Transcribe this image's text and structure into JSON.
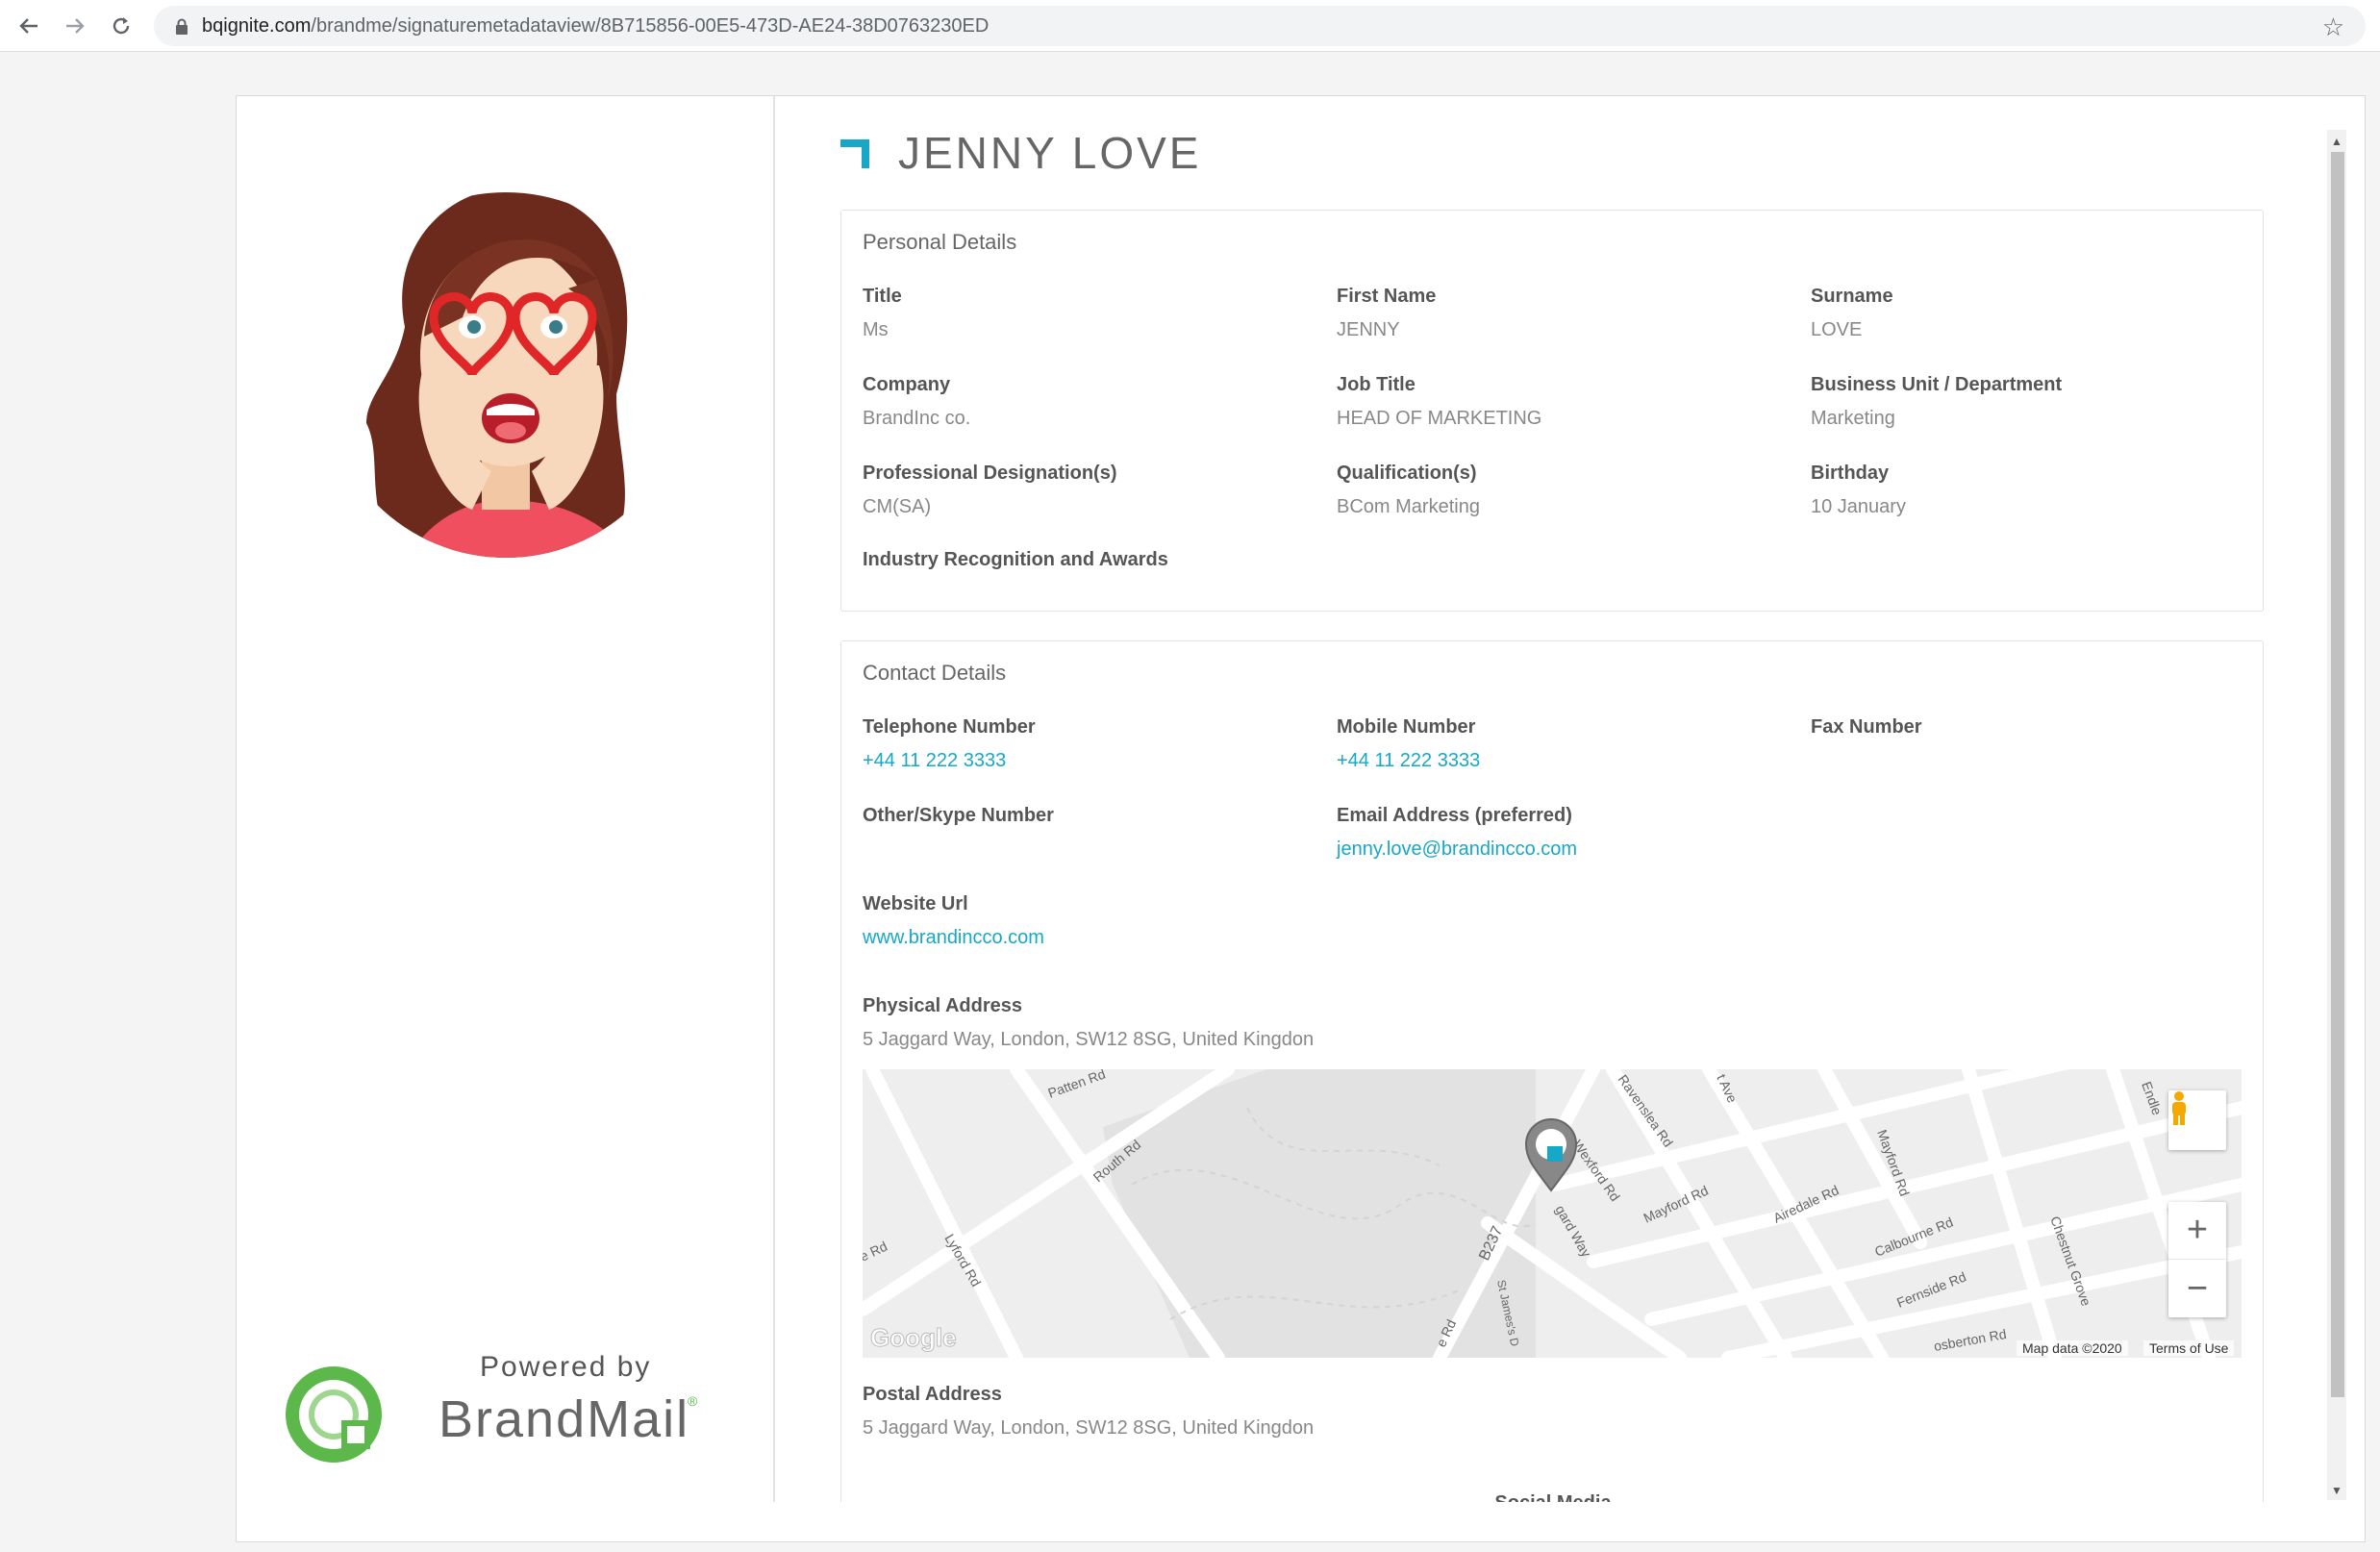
{
  "browser": {
    "url_host": "bqignite.com",
    "url_path": "/brandme/signaturemetadataview/8B715856-00E5-473D-AE24-38D0763230ED",
    "icons": [
      "back-arrow-icon",
      "forward-arrow-icon",
      "reload-icon",
      "lock-icon",
      "star-icon"
    ]
  },
  "profile": {
    "name": "JENNY LOVE"
  },
  "personal": {
    "heading": "Personal Details",
    "fields": [
      {
        "label": "Title",
        "value": "Ms"
      },
      {
        "label": "First Name",
        "value": "JENNY"
      },
      {
        "label": "Surname",
        "value": "LOVE"
      },
      {
        "label": "Company",
        "value": "BrandInc co."
      },
      {
        "label": "Job Title",
        "value": "HEAD OF MARKETING"
      },
      {
        "label": "Business Unit / Department",
        "value": "Marketing"
      },
      {
        "label": "Professional Designation(s)",
        "value": "CM(SA)"
      },
      {
        "label": "Qualification(s)",
        "value": "BCom Marketing"
      },
      {
        "label": "Birthday",
        "value": "10 January"
      },
      {
        "label": "Industry Recognition and Awards",
        "value": ""
      }
    ]
  },
  "contact": {
    "heading": "Contact Details",
    "fields": [
      {
        "label": "Telephone Number",
        "value": "+44 11 222 3333"
      },
      {
        "label": "Mobile Number",
        "value": "+44 11 222 3333"
      },
      {
        "label": "Fax Number",
        "value": ""
      },
      {
        "label": "Other/Skype Number",
        "value": ""
      },
      {
        "label": "Email Address (preferred)",
        "value": "jenny.love@brandincco.com"
      },
      {
        "label": "Website Url",
        "value": "www.brandincco.com"
      },
      {
        "label": "Physical Address",
        "value": "5 Jaggard Way, London, SW12 8SG, United Kingdon"
      },
      {
        "label": "Postal Address",
        "value": "5 Jaggard Way, London, SW12 8SG, United Kingdon"
      }
    ],
    "social_heading": "Social Media"
  },
  "map": {
    "streets": [
      "Patten Rd",
      "Routh Rd",
      "Lyford Rd",
      "e Rd",
      "B237",
      "St James's D",
      "e Rd",
      "Ravenslea Rd",
      "t Ave",
      "Wexford Rd",
      "gard Way",
      "Mayford Rd",
      "Airedale Rd",
      "Mayford Rd",
      "Calbourne Rd",
      "Fernside Rd",
      "Chestnut Grove",
      "Endle",
      "osberton Rd"
    ],
    "google_label": "Google",
    "map_data": "Map data ©2020",
    "terms": "Terms of Use",
    "zoom_in": "+",
    "zoom_out": "−"
  },
  "branding": {
    "powered_by": "Powered by",
    "brand": "BrandMail",
    "registered": "®",
    "accent_color": "#17a7c7",
    "brand_green": "#5cb84a"
  }
}
